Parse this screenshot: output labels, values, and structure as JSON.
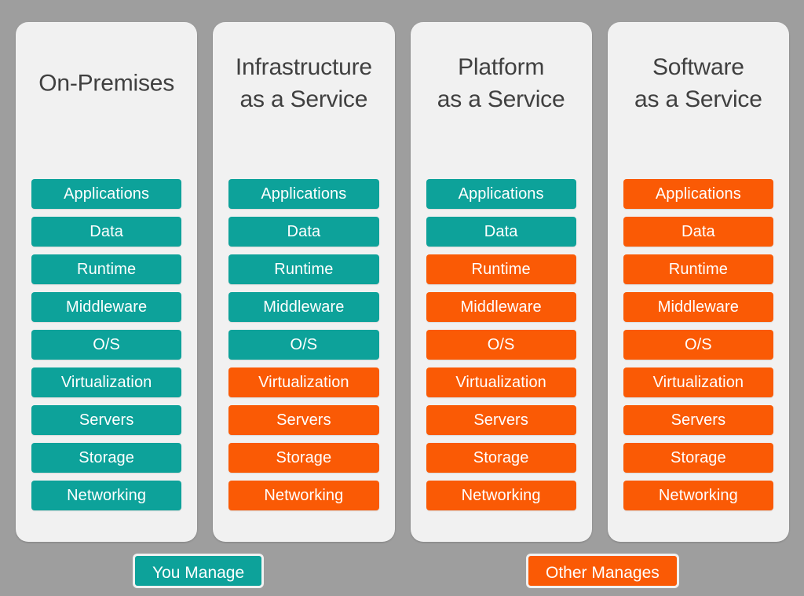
{
  "background_color": "#9e9e9e",
  "card_color": "#f1f1f1",
  "title_color": "#404040",
  "colors": {
    "you_manage": "#0da29a",
    "other_manages": "#fa5a05"
  },
  "columns": [
    {
      "id": "on-premises",
      "title": "On-Premises",
      "layers": [
        {
          "label": "Applications",
          "owner": "you"
        },
        {
          "label": "Data",
          "owner": "you"
        },
        {
          "label": "Runtime",
          "owner": "you"
        },
        {
          "label": "Middleware",
          "owner": "you"
        },
        {
          "label": "O/S",
          "owner": "you"
        },
        {
          "label": "Virtualization",
          "owner": "you"
        },
        {
          "label": "Servers",
          "owner": "you"
        },
        {
          "label": "Storage",
          "owner": "you"
        },
        {
          "label": "Networking",
          "owner": "you"
        }
      ]
    },
    {
      "id": "infrastructure-as-a-service",
      "title": "Infrastructure\nas a Service",
      "layers": [
        {
          "label": "Applications",
          "owner": "you"
        },
        {
          "label": "Data",
          "owner": "you"
        },
        {
          "label": "Runtime",
          "owner": "you"
        },
        {
          "label": "Middleware",
          "owner": "you"
        },
        {
          "label": "O/S",
          "owner": "you"
        },
        {
          "label": "Virtualization",
          "owner": "other"
        },
        {
          "label": "Servers",
          "owner": "other"
        },
        {
          "label": "Storage",
          "owner": "other"
        },
        {
          "label": "Networking",
          "owner": "other"
        }
      ]
    },
    {
      "id": "platform-as-a-service",
      "title": "Platform\nas a Service",
      "layers": [
        {
          "label": "Applications",
          "owner": "you"
        },
        {
          "label": "Data",
          "owner": "you"
        },
        {
          "label": "Runtime",
          "owner": "other"
        },
        {
          "label": "Middleware",
          "owner": "other"
        },
        {
          "label": "O/S",
          "owner": "other"
        },
        {
          "label": "Virtualization",
          "owner": "other"
        },
        {
          "label": "Servers",
          "owner": "other"
        },
        {
          "label": "Storage",
          "owner": "other"
        },
        {
          "label": "Networking",
          "owner": "other"
        }
      ]
    },
    {
      "id": "software-as-a-service",
      "title": "Software\nas a Service",
      "layers": [
        {
          "label": "Applications",
          "owner": "other"
        },
        {
          "label": "Data",
          "owner": "other"
        },
        {
          "label": "Runtime",
          "owner": "other"
        },
        {
          "label": "Middleware",
          "owner": "other"
        },
        {
          "label": "O/S",
          "owner": "other"
        },
        {
          "label": "Virtualization",
          "owner": "other"
        },
        {
          "label": "Servers",
          "owner": "other"
        },
        {
          "label": "Storage",
          "owner": "other"
        },
        {
          "label": "Networking",
          "owner": "other"
        }
      ]
    }
  ],
  "legend": {
    "you_manage_label": "You Manage",
    "other_manages_label": "Other Manages"
  }
}
